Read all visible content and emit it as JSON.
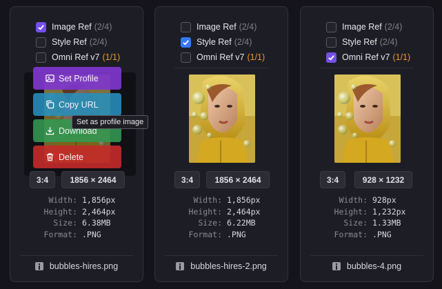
{
  "cards": [
    {
      "refs": [
        {
          "label": "Image Ref",
          "count": "(2/4)",
          "checked": true
        },
        {
          "label": "Style Ref",
          "count": "(2/4)",
          "checked": false
        },
        {
          "label": "Omni Ref v7",
          "count": "(1/1)",
          "checked": false
        }
      ],
      "actions": {
        "set_profile": "Set Profile",
        "copy_url": "Copy URL",
        "download": "Download",
        "delete": "Delete"
      },
      "tooltip": "Set as profile image",
      "ratio": "3:4",
      "dims": "1856 × 2464",
      "meta": [
        {
          "key": "Width:",
          "value": "1,856px"
        },
        {
          "key": "Height:",
          "value": "2,464px"
        },
        {
          "key": "Size:",
          "value": "6.38MB"
        },
        {
          "key": "Format:",
          "value": ".PNG"
        }
      ],
      "filename": "bubbles-hires.png"
    },
    {
      "refs": [
        {
          "label": "Image Ref",
          "count": "(2/4)",
          "checked": false
        },
        {
          "label": "Style Ref",
          "count": "(2/4)",
          "checked": true
        },
        {
          "label": "Omni Ref v7",
          "count": "(1/1)",
          "checked": false
        }
      ],
      "ratio": "3:4",
      "dims": "1856 × 2464",
      "meta": [
        {
          "key": "Width:",
          "value": "1,856px"
        },
        {
          "key": "Height:",
          "value": "2,464px"
        },
        {
          "key": "Size:",
          "value": "6.22MB"
        },
        {
          "key": "Format:",
          "value": ".PNG"
        }
      ],
      "filename": "bubbles-hires-2.png"
    },
    {
      "refs": [
        {
          "label": "Image Ref",
          "count": "(2/4)",
          "checked": false
        },
        {
          "label": "Style Ref",
          "count": "(2/4)",
          "checked": false
        },
        {
          "label": "Omni Ref v7",
          "count": "(1/1)",
          "checked": true
        }
      ],
      "ratio": "3:4",
      "dims": "928 × 1232",
      "meta": [
        {
          "key": "Width:",
          "value": "928px"
        },
        {
          "key": "Height:",
          "value": "1,232px"
        },
        {
          "key": "Size:",
          "value": "1.33MB"
        },
        {
          "key": "Format:",
          "value": ".PNG"
        }
      ],
      "filename": "bubbles-4.png"
    }
  ],
  "colors": {
    "checkbox_blue": "#3478f6",
    "checkbox_purple": "#7550e8",
    "omni_count": "#e89a2c",
    "set_profile_bg": "#7e36cd",
    "copy_url_bg": "#268ebc",
    "download_bg": "#319852",
    "delete_bg": "#c42a2a"
  },
  "icons": {
    "set_profile": "image-icon",
    "copy_url": "copy-icon",
    "download": "download-icon",
    "delete": "trash-icon",
    "file": "file-info-icon",
    "checkbox": "check-icon"
  }
}
